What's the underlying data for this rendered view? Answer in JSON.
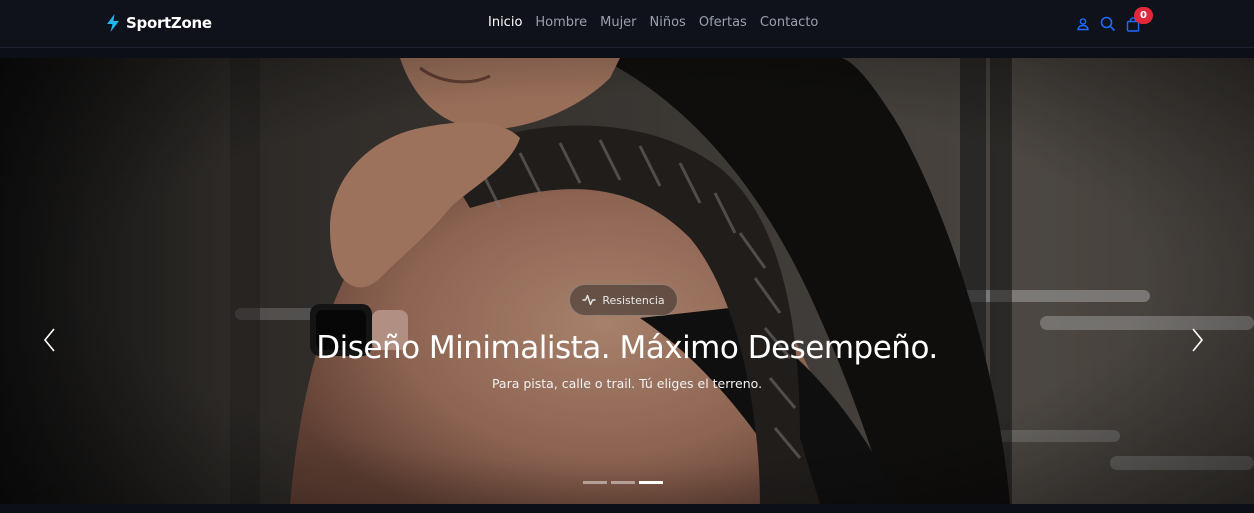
{
  "brand": {
    "name": "SportZone",
    "icon": "lightning-bolt-icon",
    "accent_color": "#1fb6e8"
  },
  "nav": {
    "links": [
      {
        "label": "Inicio",
        "active": true
      },
      {
        "label": "Hombre",
        "active": false
      },
      {
        "label": "Mujer",
        "active": false
      },
      {
        "label": "Niños",
        "active": false
      },
      {
        "label": "Ofertas",
        "active": false
      },
      {
        "label": "Contacto",
        "active": false
      }
    ],
    "icons": [
      "user-icon",
      "search-icon",
      "shopping-bag-icon"
    ],
    "icon_color": "#1e6bff",
    "cart_count": "0",
    "badge_color": "#e0283a"
  },
  "hero": {
    "badge": {
      "icon": "activity-pulse-icon",
      "label": "Resistencia"
    },
    "title": "Diseño Minimalista. Máximo Desempeño.",
    "subtitle": "Para pista, calle o trail. Tú eliges el terreno.",
    "prev_icon": "chevron-left-icon",
    "next_icon": "chevron-right-icon",
    "slide_count": 3,
    "active_slide": 3
  }
}
